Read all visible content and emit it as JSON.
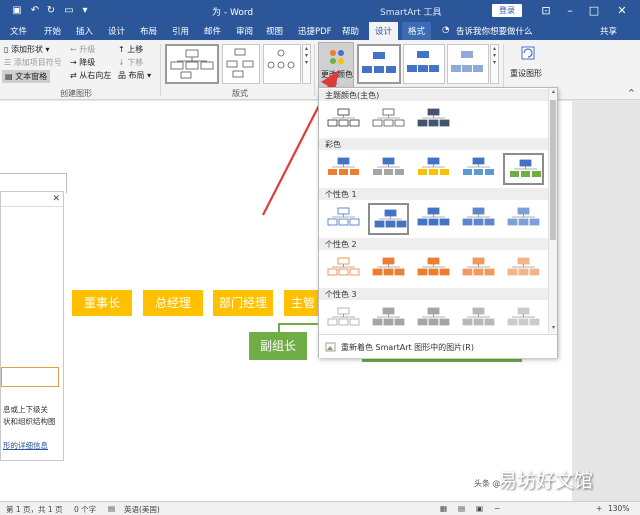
{
  "titlebar": {
    "doc_title": "为 - Word",
    "context_title": "SmartArt 工具",
    "login": "登录"
  },
  "tabs": [
    "文件",
    "开始",
    "插入",
    "设计",
    "布局",
    "引用",
    "邮件",
    "审阅",
    "视图",
    "迅捷PDF",
    "帮助",
    "设计",
    "格式"
  ],
  "tell_me": "告诉我你想要做什么",
  "share": "共享",
  "ribbon": {
    "create_graphic": {
      "add_shape": "添加形状",
      "add_bullet": "添加项目符号",
      "text_pane": "文本窗格",
      "promote": "升级",
      "demote": "降级",
      "right_to_left": "从右向左",
      "move_up": "上移",
      "move_down": "下移",
      "layout": "布局",
      "group_label": "创建图形"
    },
    "layouts_label": "版式",
    "change_colors": "更改颜色",
    "reset_graphic": "重设图形"
  },
  "diagram": {
    "nodes": [
      "董事长",
      "总经理",
      "部门经理",
      "主管"
    ],
    "sub_node": "副组长",
    "primary_color": "#ffc000",
    "secondary_color": "#70ad47"
  },
  "text_pane": {
    "help_lines": [
      "息或上下级关",
      "状和组织结构图"
    ],
    "link": "形的详细信息"
  },
  "dropdown": {
    "sections": [
      {
        "label": "主题颜色(主色)"
      },
      {
        "label": "彩色"
      },
      {
        "label": "个性色 1"
      },
      {
        "label": "个性色 2"
      },
      {
        "label": "个性色 3"
      }
    ],
    "footer": "重新着色 SmartArt 图形中的图片(R)",
    "colors": {
      "dark": "#44546a",
      "blue": "#4472c4",
      "orange": "#ed7d31",
      "gray": "#a5a5a5",
      "gold": "#ffc000",
      "lightblue": "#5b9bd5",
      "green": "#70ad47"
    }
  },
  "statusbar": {
    "page": "第 1 页，共 1 页",
    "words": "0 个字",
    "language": "英语(美国)",
    "zoom": "130%"
  },
  "watermark": "易坊好文馆",
  "watermark_brand": "头条 @"
}
